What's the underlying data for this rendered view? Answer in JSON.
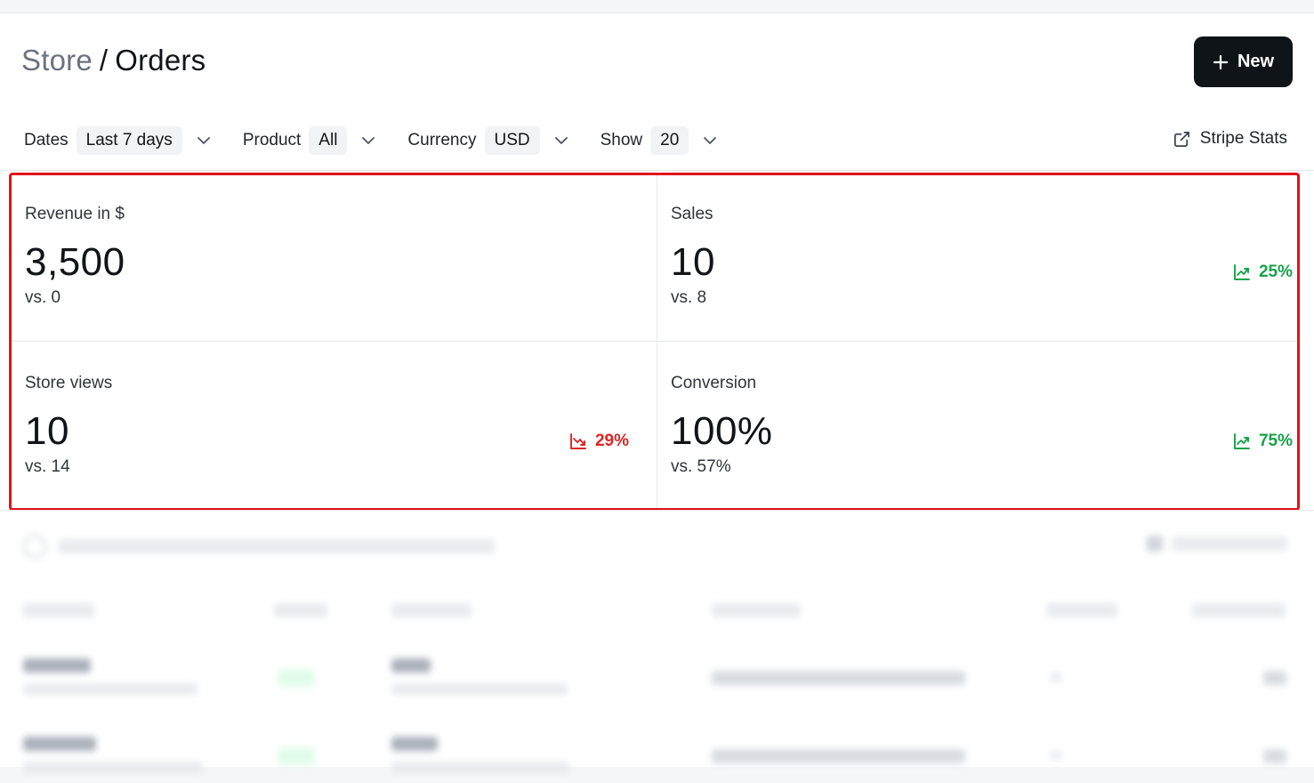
{
  "header": {
    "breadcrumb": {
      "parent": "Store",
      "separator": "/",
      "current": "Orders"
    },
    "new_button_label": "New"
  },
  "filters": [
    {
      "label": "Dates",
      "value": "Last 7 days"
    },
    {
      "label": "Product",
      "value": "All"
    },
    {
      "label": "Currency",
      "value": "USD"
    },
    {
      "label": "Show",
      "value": "20"
    }
  ],
  "stripe_link_label": "Stripe Stats",
  "stats": {
    "revenue": {
      "label": "Revenue in $",
      "value": "3,500",
      "comparison": "vs. 0",
      "trend": ""
    },
    "sales": {
      "label": "Sales",
      "value": "10",
      "comparison": "vs. 8",
      "trend": "25%",
      "trend_direction": "up"
    },
    "store_views": {
      "label": "Store views",
      "value": "10",
      "comparison": "vs. 14",
      "trend": "29%",
      "trend_direction": "down"
    },
    "conversion": {
      "label": "Conversion",
      "value": "100%",
      "comparison": "vs. 57%",
      "trend": "75%",
      "trend_direction": "up"
    }
  },
  "colors": {
    "trend_up": "#16a34a",
    "trend_down": "#dc2626",
    "highlight_border": "#e0131b",
    "primary_button": "#0f1419"
  }
}
